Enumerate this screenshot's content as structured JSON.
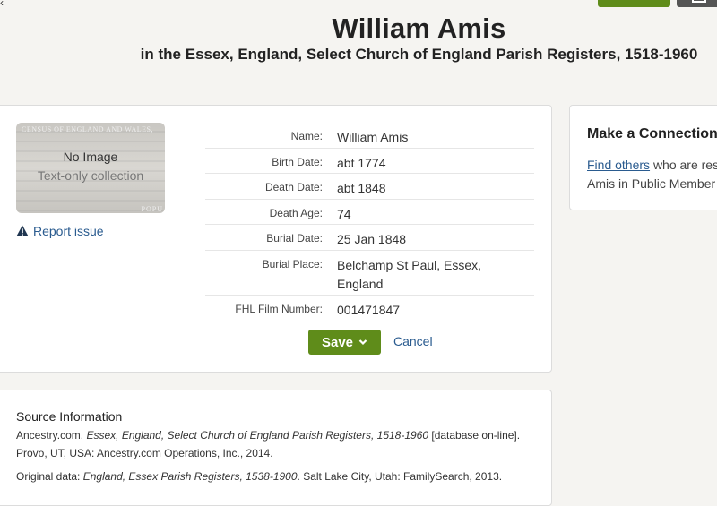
{
  "header": {
    "title": "William Amis",
    "subtitle": "in the Essex, England, Select Church of England Parish Registers, 1518-1960"
  },
  "thumbnail": {
    "no_image": "No Image",
    "text_only": "Text-only collection",
    "bg_text_top": "CENSUS OF ENGLAND AND WALES,",
    "bg_text_bottom": "POPU"
  },
  "report_issue": {
    "label": "Report issue",
    "icon": "warning-icon"
  },
  "facts": [
    {
      "label": "Name:",
      "value": "William Amis"
    },
    {
      "label": "Birth Date:",
      "value": "abt 1774"
    },
    {
      "label": "Death Date:",
      "value": "abt 1848"
    },
    {
      "label": "Death Age:",
      "value": "74"
    },
    {
      "label": "Burial Date:",
      "value": "25 Jan 1848"
    },
    {
      "label": "Burial Place:",
      "value": "Belchamp St Paul, Essex, England"
    },
    {
      "label": "FHL Film Number:",
      "value": "001471847"
    }
  ],
  "actions": {
    "save_label": "Save",
    "cancel_label": "Cancel"
  },
  "connection": {
    "title": "Make a Connection",
    "link_text": "Find others",
    "text_rest": "who are res",
    "text_line2": "Amis in Public Member"
  },
  "source": {
    "heading": "Source Information",
    "line1_pre": "Ancestry.com. ",
    "line1_italic": "Essex, England, Select Church of England Parish Registers, 1518-1960",
    "line1_post": " [database on-line].",
    "line2": "Provo, UT, USA: Ancestry.com Operations, Inc., 2014.",
    "line3_pre": "Original data: ",
    "line3_italic": "England, Essex Parish Registers, 1538-1900",
    "line3_post": ". Salt Lake City, Utah: FamilySearch, 2013."
  },
  "colors": {
    "accent_green": "#5f8c1a",
    "link_blue": "#2a5b8f",
    "background": "#f5f4f1"
  }
}
